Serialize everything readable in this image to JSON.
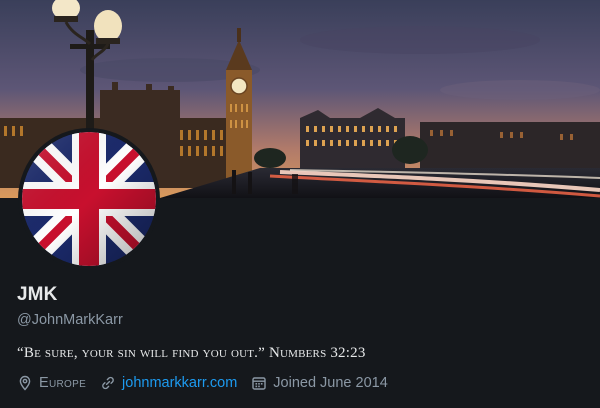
{
  "profile": {
    "name": "JMK",
    "handle": "@JohnMarkKarr",
    "bio": "“Be sure, your sin will find you out.” Numbers 32:23",
    "location": "Europe",
    "website": "johnmarkkarr.com",
    "joined": "Joined June 2014"
  },
  "icons": {
    "location": "map-pin-icon",
    "website": "link-icon",
    "joined": "calendar-icon"
  },
  "colors": {
    "background": "#15181c",
    "text": "#e7e9ea",
    "secondary": "#8b98a5",
    "link": "#1d9bf0"
  }
}
